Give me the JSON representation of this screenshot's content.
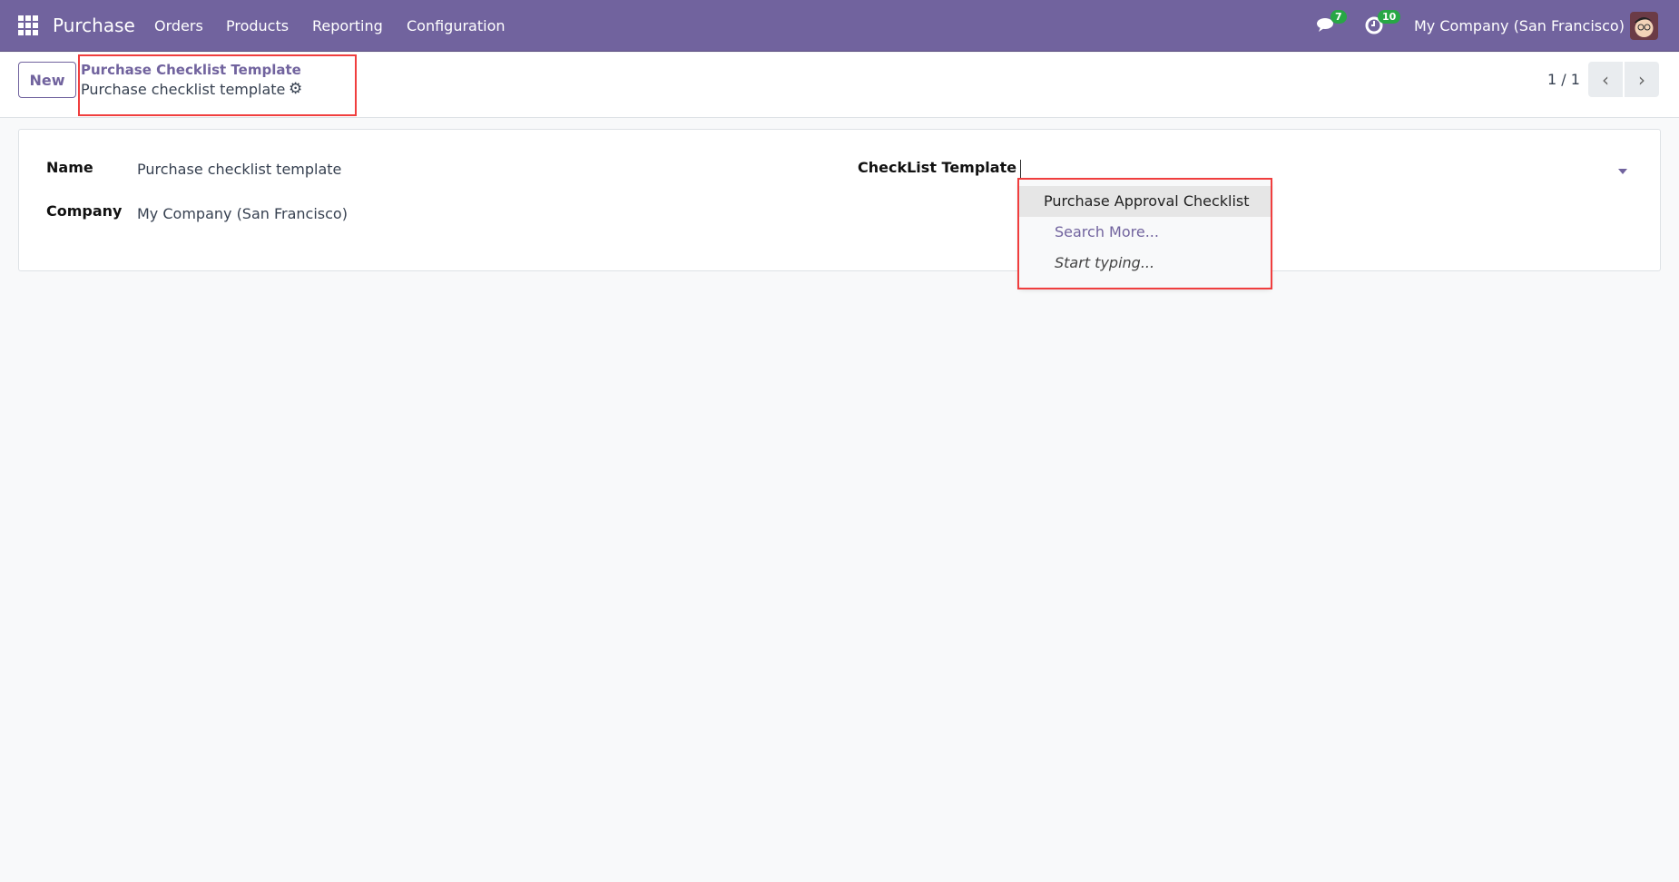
{
  "nav": {
    "app": "Purchase",
    "menu": [
      "Orders",
      "Products",
      "Reporting",
      "Configuration"
    ],
    "messages_count": "7",
    "activities_count": "10",
    "company": "My Company (San Francisco)"
  },
  "control": {
    "new_label": "New",
    "breadcrumb_parent": "Purchase Checklist Template",
    "breadcrumb_current": "Purchase checklist template",
    "pager": "1 / 1"
  },
  "form": {
    "name_label": "Name",
    "name_value": "Purchase checklist template",
    "company_label": "Company",
    "company_value": "My Company (San Francisco)",
    "checklist_label": "CheckList Template",
    "checklist_value": ""
  },
  "dropdown": {
    "options": [
      "Purchase Approval Checklist"
    ],
    "search_more": "Search More...",
    "start_typing": "Start typing..."
  },
  "colors": {
    "brand": "#71639e",
    "highlight": "#f03e3e",
    "badge": "#28a745"
  }
}
